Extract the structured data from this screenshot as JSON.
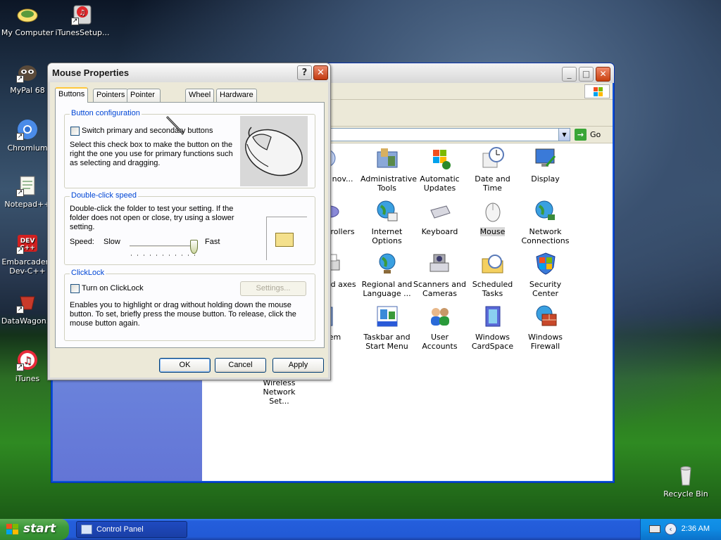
{
  "desktop": {
    "icons": [
      {
        "label": "My Computer"
      },
      {
        "label": "iTunesSetup..."
      },
      {
        "label": "MyPal 68"
      },
      {
        "label": "Chromium"
      },
      {
        "label": "Notepad++"
      },
      {
        "label": "Embarcadero Dev-C++"
      },
      {
        "label": "DataWagon..."
      },
      {
        "label": "iTunes"
      },
      {
        "label": "Recycle Bin"
      }
    ]
  },
  "control_panel": {
    "go_label": "Go",
    "items": [
      {
        "label": "dd or nov..."
      },
      {
        "label": "Administrative Tools"
      },
      {
        "label": "Automatic Updates"
      },
      {
        "label": "Date and Time"
      },
      {
        "label": "Display"
      },
      {
        "label": "ame trollers"
      },
      {
        "label": "Internet Options"
      },
      {
        "label": "Keyboard"
      },
      {
        "label": "Mouse"
      },
      {
        "label": "Network Connections"
      },
      {
        "label": "ers and axes"
      },
      {
        "label": "Regional and Language ..."
      },
      {
        "label": "Scanners and Cameras"
      },
      {
        "label": "Scheduled Tasks"
      },
      {
        "label": "Security Center"
      },
      {
        "label": "stem"
      },
      {
        "label": "Taskbar and Start Menu"
      },
      {
        "label": "User Accounts"
      },
      {
        "label": "Windows CardSpace"
      },
      {
        "label": "Windows Firewall"
      },
      {
        "label": "Wireless Network Set..."
      }
    ]
  },
  "dialog": {
    "title": "Mouse Properties",
    "help_label": "?",
    "close_label": "✕",
    "tabs": [
      "Buttons",
      "Pointers",
      "Pointer Options",
      "Wheel",
      "Hardware"
    ],
    "active_tab": "Buttons",
    "button_config": {
      "legend": "Button configuration",
      "checkbox_label": "Switch primary and secondary buttons",
      "checked": false,
      "description": "Select this check box to make the button on the right the one you use for primary functions such as selecting and dragging."
    },
    "double_click": {
      "legend": "Double-click speed",
      "description": "Double-click the folder to test your setting. If the folder does not open or close, try using a slower setting.",
      "speed_label": "Speed:",
      "slow_label": "Slow",
      "fast_label": "Fast",
      "speed_value_fraction": 0.95
    },
    "clicklock": {
      "legend": "ClickLock",
      "checkbox_label": "Turn on ClickLock",
      "checked": false,
      "settings_label": "Settings...",
      "description": "Enables you to highlight or drag without holding down the mouse button. To set, briefly press the mouse button. To release, click the mouse button again."
    },
    "buttons": {
      "ok": "OK",
      "cancel": "Cancel",
      "apply": "Apply"
    }
  },
  "taskbar": {
    "start_label": "start",
    "task_label": "Control Panel",
    "clock": "2:36 AM"
  },
  "colors": {
    "xp_blue": "#0a50d8",
    "legend_blue": "#0046d5",
    "start_green": "#3c9a3a",
    "selection": "#316ac5"
  }
}
